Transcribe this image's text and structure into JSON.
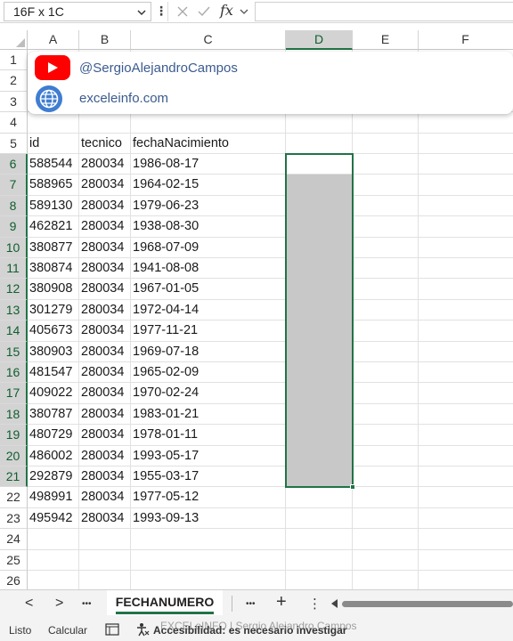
{
  "formula_bar": {
    "name_box": "16F x 1C",
    "fx_label": "fx"
  },
  "columns": [
    "A",
    "B",
    "C",
    "D",
    "E",
    "F"
  ],
  "selected_column": "D",
  "rows": [
    "1",
    "2",
    "3",
    "4",
    "5",
    "6",
    "7",
    "8",
    "9",
    "10",
    "11",
    "12",
    "13",
    "14",
    "15",
    "16",
    "17",
    "18",
    "19",
    "20",
    "21",
    "22",
    "23",
    "24",
    "25",
    "26"
  ],
  "selected_rows": [
    "6",
    "7",
    "8",
    "9",
    "10",
    "11",
    "12",
    "13",
    "14",
    "15",
    "16",
    "17",
    "18",
    "19",
    "20",
    "21"
  ],
  "headers": {
    "id": "id",
    "tecnico": "tecnico",
    "fecha": "fechaNacimiento"
  },
  "table": [
    [
      "588544",
      "280034",
      "1986-08-17"
    ],
    [
      "588965",
      "280034",
      "1964-02-15"
    ],
    [
      "589130",
      "280034",
      "1979-06-23"
    ],
    [
      "462821",
      "280034",
      "1938-08-30"
    ],
    [
      "380877",
      "280034",
      "1968-07-09"
    ],
    [
      "380874",
      "280034",
      "1941-08-08"
    ],
    [
      "380908",
      "280034",
      "1967-01-05"
    ],
    [
      "301279",
      "280034",
      "1972-04-14"
    ],
    [
      "405673",
      "280034",
      "1977-11-21"
    ],
    [
      "380903",
      "280034",
      "1969-07-18"
    ],
    [
      "481547",
      "280034",
      "1965-02-09"
    ],
    [
      "409022",
      "280034",
      "1970-02-24"
    ],
    [
      "380787",
      "280034",
      "1983-01-21"
    ],
    [
      "480729",
      "280034",
      "1978-01-11"
    ],
    [
      "486002",
      "280034",
      "1993-05-17"
    ],
    [
      "292879",
      "280034",
      "1955-03-17"
    ],
    [
      "498991",
      "280034",
      "1977-05-12"
    ],
    [
      "495942",
      "280034",
      "1993-09-13"
    ]
  ],
  "social": {
    "youtube": "@SergioAlejandroCampos",
    "website": "exceleinfo.com"
  },
  "sheet_tabs": {
    "active": "FECHANUMERO",
    "prev": "<",
    "next": ">",
    "more": "•••",
    "more_right": "•••",
    "add": "+",
    "options": "⋮"
  },
  "status_bar": {
    "ready": "Listo",
    "calc": "Calcular",
    "accessibility": "Accesibilidad: es necesario investigar",
    "watermark": "EXCELeINFO | Sergio Alejandro Campos"
  },
  "colors": {
    "excel_green": "#217346",
    "youtube_red": "#ff0000",
    "link_blue": "#3b5b8f",
    "selection_gray": "#c8c8c8"
  },
  "icons": [
    "chevron-down-icon",
    "cancel-icon",
    "check-icon",
    "youtube-icon",
    "globe-icon",
    "page-layout-icon",
    "accessibility-icon"
  ]
}
